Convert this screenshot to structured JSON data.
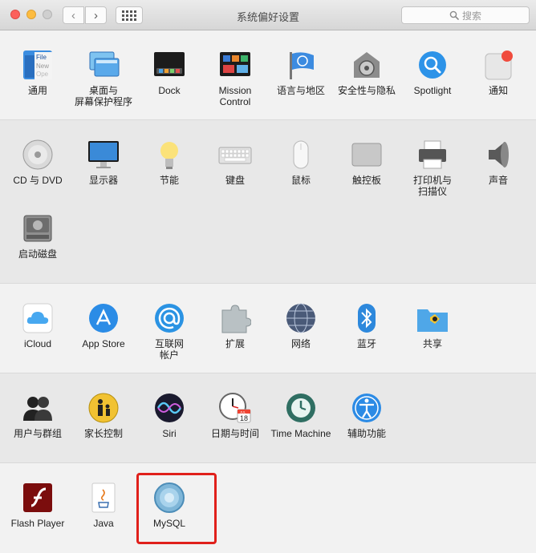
{
  "window": {
    "title": "系统偏好设置",
    "search_placeholder": "搜索",
    "nav_back": "‹",
    "nav_forward": "›"
  },
  "sections": [
    {
      "items": [
        {
          "id": "general",
          "label": "通用",
          "icon": "general-icon"
        },
        {
          "id": "desktop",
          "label": "桌面与\n屏幕保护程序",
          "icon": "desktop-screensaver-icon"
        },
        {
          "id": "dock",
          "label": "Dock",
          "icon": "dock-icon"
        },
        {
          "id": "mission",
          "label": "Mission\nControl",
          "icon": "mission-control-icon"
        },
        {
          "id": "language",
          "label": "语言与地区",
          "icon": "language-region-icon"
        },
        {
          "id": "security",
          "label": "安全性与隐私",
          "icon": "security-privacy-icon"
        },
        {
          "id": "spotlight",
          "label": "Spotlight",
          "icon": "spotlight-icon"
        },
        {
          "id": "notifications",
          "label": "通知",
          "icon": "notifications-icon"
        }
      ]
    },
    {
      "items": [
        {
          "id": "cddvd",
          "label": "CD 与 DVD",
          "icon": "cd-dvd-icon"
        },
        {
          "id": "displays",
          "label": "显示器",
          "icon": "displays-icon"
        },
        {
          "id": "energy",
          "label": "节能",
          "icon": "energy-saver-icon"
        },
        {
          "id": "keyboard",
          "label": "键盘",
          "icon": "keyboard-icon"
        },
        {
          "id": "mouse",
          "label": "鼠标",
          "icon": "mouse-icon"
        },
        {
          "id": "trackpad",
          "label": "触控板",
          "icon": "trackpad-icon"
        },
        {
          "id": "printers",
          "label": "打印机与\n扫描仪",
          "icon": "printer-icon"
        },
        {
          "id": "sound",
          "label": "声音",
          "icon": "sound-icon"
        },
        {
          "id": "startup",
          "label": "启动磁盘",
          "icon": "startup-disk-icon"
        }
      ]
    },
    {
      "items": [
        {
          "id": "icloud",
          "label": "iCloud",
          "icon": "icloud-icon"
        },
        {
          "id": "appstore",
          "label": "App Store",
          "icon": "app-store-icon"
        },
        {
          "id": "internet",
          "label": "互联网\n帐户",
          "icon": "internet-accounts-icon"
        },
        {
          "id": "extensions",
          "label": "扩展",
          "icon": "extensions-icon"
        },
        {
          "id": "network",
          "label": "网络",
          "icon": "network-icon"
        },
        {
          "id": "bluetooth",
          "label": "蓝牙",
          "icon": "bluetooth-icon"
        },
        {
          "id": "sharing",
          "label": "共享",
          "icon": "sharing-icon"
        }
      ]
    },
    {
      "items": [
        {
          "id": "users",
          "label": "用户与群组",
          "icon": "users-groups-icon"
        },
        {
          "id": "parental",
          "label": "家长控制",
          "icon": "parental-controls-icon"
        },
        {
          "id": "siri",
          "label": "Siri",
          "icon": "siri-icon"
        },
        {
          "id": "datetime",
          "label": "日期与时间",
          "icon": "date-time-icon"
        },
        {
          "id": "timemachine",
          "label": "Time Machine",
          "icon": "time-machine-icon"
        },
        {
          "id": "accessibility",
          "label": "辅助功能",
          "icon": "accessibility-icon"
        }
      ]
    },
    {
      "items": [
        {
          "id": "flash",
          "label": "Flash Player",
          "icon": "flash-player-icon"
        },
        {
          "id": "java",
          "label": "Java",
          "icon": "java-icon"
        },
        {
          "id": "mysql",
          "label": "MySQL",
          "icon": "mysql-icon"
        }
      ]
    }
  ],
  "icon_text": {
    "general_file": "File",
    "general_new": "New",
    "general_open": "Ope",
    "calendar_month": "JUL",
    "calendar_day": "18"
  },
  "colors": {
    "highlight_border": "#e0201b"
  }
}
